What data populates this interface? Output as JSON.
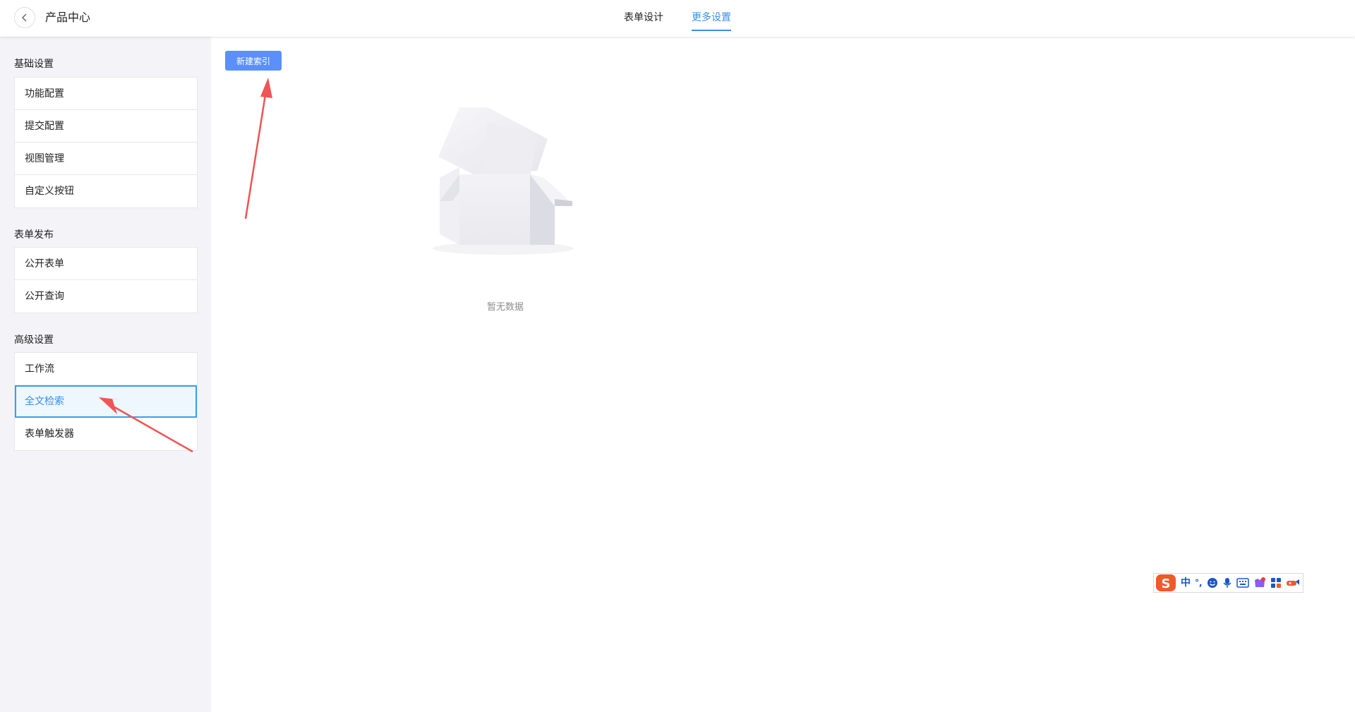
{
  "header": {
    "title": "产品中心",
    "tabs": [
      {
        "label": "表单设计",
        "active": false
      },
      {
        "label": "更多设置",
        "active": true
      }
    ]
  },
  "sidebar": {
    "groups": [
      {
        "title": "基础设置",
        "items": [
          "功能配置",
          "提交配置",
          "视图管理",
          "自定义按钮"
        ]
      },
      {
        "title": "表单发布",
        "items": [
          "公开表单",
          "公开查询"
        ]
      },
      {
        "title": "高级设置",
        "items": [
          "工作流",
          "全文检索",
          "表单触发器"
        ]
      }
    ],
    "active_item": "全文检索"
  },
  "main": {
    "new_index_button": "新建索引",
    "empty_text": "暂无数据"
  },
  "ime_toolbar": {
    "mode": "中",
    "punctuation": "°,",
    "icons": [
      "sogou-logo-icon",
      "emoji-icon",
      "microphone-icon",
      "keyboard-icon",
      "skin-icon",
      "toolbox-icon",
      "more-icon"
    ]
  },
  "colors": {
    "accent": "#3a8ee6",
    "primary_button": "#5b8ff9",
    "annotation_arrow": "#f05454"
  }
}
